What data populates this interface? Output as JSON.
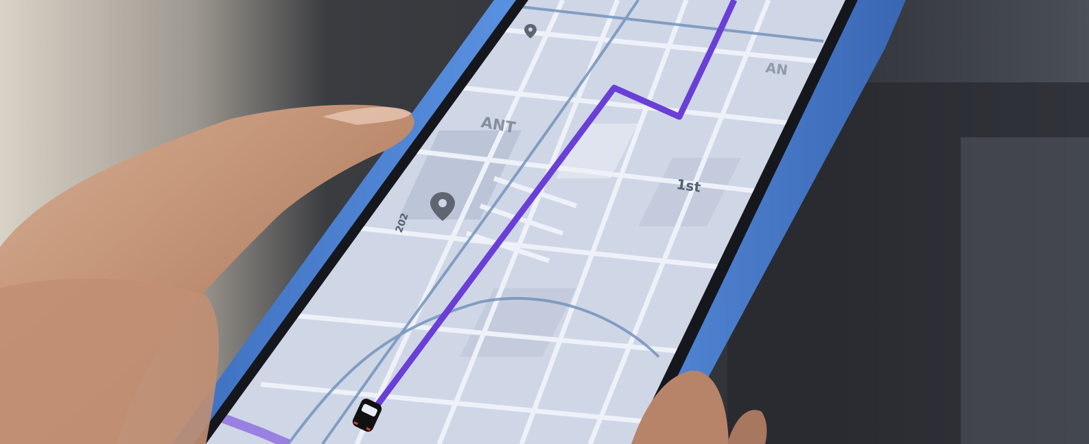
{
  "photo": {
    "subject": "hand-holding-phone-with-navigation-map",
    "colors": {
      "case": "#4f86d6",
      "route": "#6a3fd6",
      "map_bg": "#cfd6e6",
      "street": "#eef1f8",
      "water_line": "#6d8fb8",
      "skin": "#c79c80",
      "background_dark": "#2a2d33"
    }
  },
  "map": {
    "street_label_1st": "1st",
    "street_label_202": "202",
    "district_label": "ANT",
    "corner_label": "AN",
    "pin_icon": "location-pin-icon",
    "vehicle_icon": "car-icon"
  }
}
